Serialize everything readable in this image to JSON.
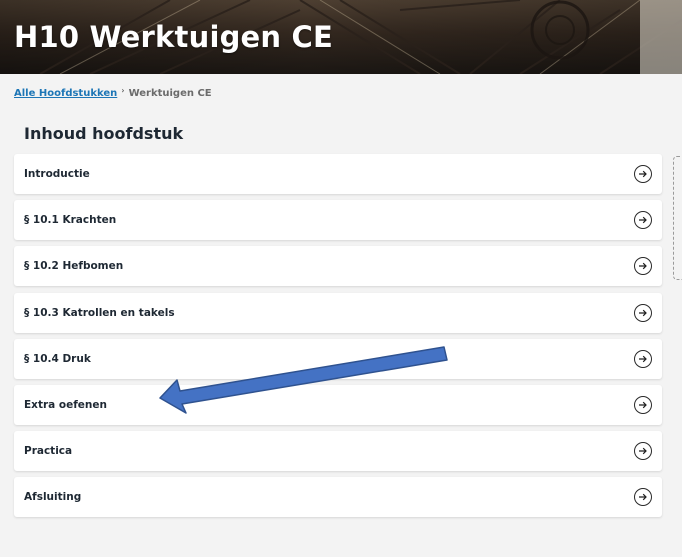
{
  "hero": {
    "title": "H10 Werktuigen CE"
  },
  "breadcrumb": {
    "link": "Alle Hoofdstukken",
    "separator": "›",
    "current": "Werktuigen CE"
  },
  "section": {
    "title": "Inhoud hoofdstuk"
  },
  "items": [
    {
      "label": "Introductie"
    },
    {
      "label": "§ 10.1   Krachten"
    },
    {
      "label": "§ 10.2   Hefbomen"
    },
    {
      "label": "§ 10.3   Katrollen en takels"
    },
    {
      "label": "§ 10.4   Druk"
    },
    {
      "label": "Extra oefenen"
    },
    {
      "label": "Practica"
    },
    {
      "label": "Afsluiting"
    }
  ],
  "icons": {
    "item_action": "arrow-right-icon",
    "annotation": "pointer-arrow"
  },
  "colors": {
    "link": "#1d76b6",
    "annotation_fill": "#4472c4",
    "annotation_stroke": "#2f528f"
  }
}
